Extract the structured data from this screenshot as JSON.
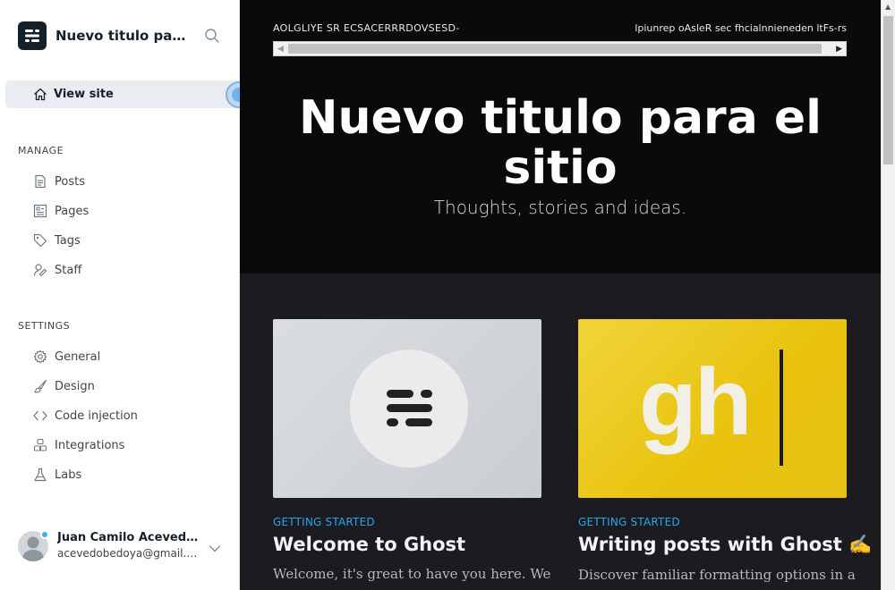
{
  "sidebar": {
    "brand_title": "Nuevo titulo para el sitio",
    "view_site_label": "View site",
    "manage_title": "MANAGE",
    "manage_items": [
      {
        "label": "Posts",
        "icon": "posts-icon"
      },
      {
        "label": "Pages",
        "icon": "pages-icon"
      },
      {
        "label": "Tags",
        "icon": "tag-icon"
      },
      {
        "label": "Staff",
        "icon": "staff-icon"
      }
    ],
    "settings_title": "SETTINGS",
    "settings_items": [
      {
        "label": "General",
        "icon": "gear-icon"
      },
      {
        "label": "Design",
        "icon": "brush-icon"
      },
      {
        "label": "Code injection",
        "icon": "code-icon"
      },
      {
        "label": "Integrations",
        "icon": "integrations-icon"
      },
      {
        "label": "Labs",
        "icon": "flask-icon"
      }
    ],
    "user": {
      "name": "Juan Camilo Acevedo Bedoya",
      "email": "acevedobedoya@gmail.com",
      "status_color": "#3eb0ef"
    }
  },
  "preview": {
    "top_left_text": "AOLGLIYE SR ECSACERRRDOVSESD-",
    "top_right_text": "lpiunrep oAsleR sec fhcialnnieneden ltFs-rs",
    "site_title": "Nuevo titulo para el sitio",
    "site_description": "Thoughts, stories and ideas.",
    "cards": [
      {
        "tag": "GETTING STARTED",
        "title": "Welcome to Ghost",
        "excerpt": "Welcome, it's great to have you here. We"
      },
      {
        "tag": "GETTING STARTED",
        "title": "Writing posts with Ghost ✍️",
        "excerpt": "Discover familiar formatting options in a",
        "image_text": "gh"
      }
    ]
  },
  "colors": {
    "accent": "#26a8ed",
    "sidebar_bg": "#ffffff",
    "hero_bg": "#0a0a0b",
    "content_bg": "#1c1c20",
    "card_yellow": "#ebc613"
  }
}
